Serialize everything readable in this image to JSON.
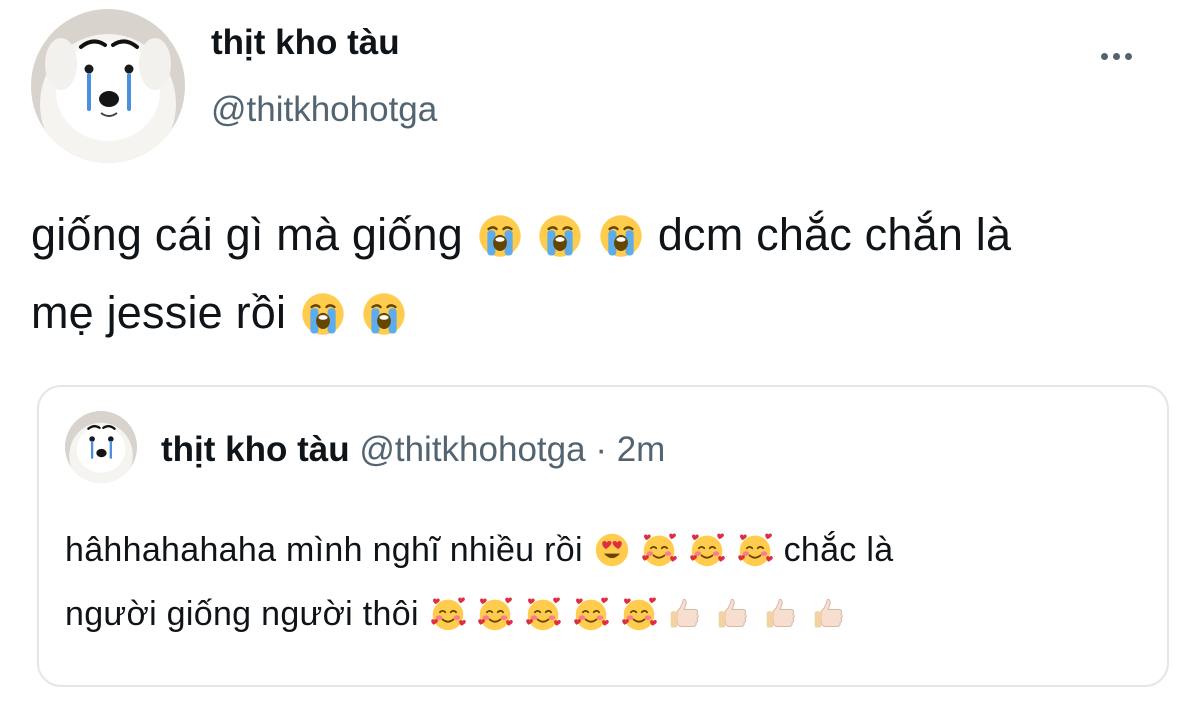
{
  "tweet": {
    "display_name": "thịt kho tàu",
    "handle": "@thitkhohotga",
    "more_icon": "more-horizontal-icon",
    "text_line1": "giống cái gì mà giống",
    "text_line1b": "dcm chắc chắn là",
    "text_line2": "mẹ jessie rồi",
    "emoji": [
      "loudly-crying-face",
      "smiling-face-with-heart-eyes",
      "smiling-face-with-hearts",
      "thumbs-up-light-skin-tone"
    ]
  },
  "quote": {
    "display_name": "thịt kho tàu",
    "handle": "@thitkhohotga",
    "separator": "·",
    "time": "2m",
    "text_line1": "hâhhahahaha mình nghĩ nhiều rồi",
    "text_line1b": "chắc là",
    "text_line2": "người giống người thôi"
  },
  "colors": {
    "text_primary": "#0f1419",
    "text_secondary": "#536471",
    "border": "#e3e7ea",
    "background": "#ffffff"
  }
}
